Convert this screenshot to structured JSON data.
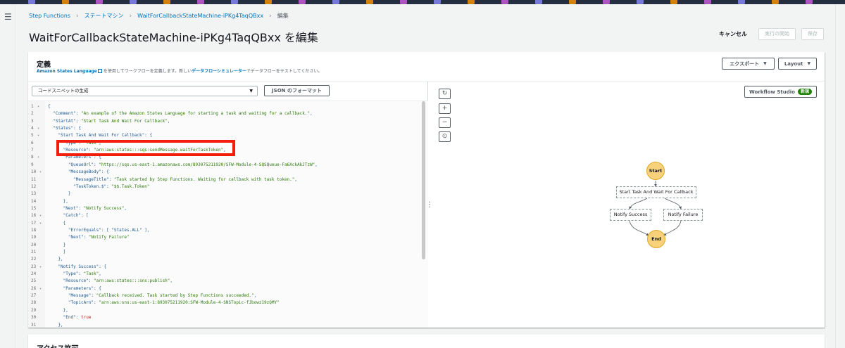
{
  "breadcrumb": {
    "items": [
      "Step Functions",
      "ステートマシン",
      "WaitForCallbackStateMachine-iPKg4TaqQBxx"
    ],
    "current": "編集"
  },
  "page": {
    "title": "WaitForCallbackStateMachine-iPKg4TaqQBxx を編集"
  },
  "header_actions": {
    "cancel": "キャンセル",
    "start_execution": "実行の開始",
    "save": "保存"
  },
  "definition": {
    "title": "定義",
    "desc_link": "Amazon States Language",
    "desc_mid": "を使用してワークフローを定義します。新しい",
    "desc_link2": "データフローシミュレーター",
    "desc_end": "でデータフローをテストしてください。",
    "export_label": "エクスポート",
    "layout_label": "Layout",
    "snippet_placeholder": "コードスニペットの生成",
    "format_button": "JSON のフォーマット"
  },
  "code_lines": [
    {
      "n": "1",
      "fold": true,
      "text": "{"
    },
    {
      "n": "2",
      "fold": false,
      "text": "  \"Comment\": \"An example of the Amazon States Language for starting a task and waiting for a callback.\","
    },
    {
      "n": "3",
      "fold": false,
      "text": "  \"StartAt\": \"Start Task And Wait For Callback\","
    },
    {
      "n": "4",
      "fold": true,
      "text": "  \"States\": {"
    },
    {
      "n": "5",
      "fold": true,
      "text": "    \"Start Task And Wait For Callback\": {"
    },
    {
      "n": "6",
      "fold": false,
      "text": "      \"Type\": \"Task\","
    },
    {
      "n": "7",
      "fold": false,
      "text": "      \"Resource\": \"arn:aws:states:::sqs:sendMessage.waitForTaskToken\","
    },
    {
      "n": "8",
      "fold": true,
      "text": "      \"Parameters\": {"
    },
    {
      "n": "9",
      "fold": false,
      "text": "        \"QueueUrl\": \"https://sqs.us-east-1.amazonaws.com/893075211920/SFW-Module-4-SQSQueue-Fa6XckAkJTzW\","
    },
    {
      "n": "10",
      "fold": true,
      "text": "        \"MessageBody\": {"
    },
    {
      "n": "11",
      "fold": false,
      "text": "          \"MessageTitle\": \"Task started by Step Functions. Waiting for callback with task token.\","
    },
    {
      "n": "12",
      "fold": false,
      "text": "          \"TaskToken.$\": \"$$.Task.Token\""
    },
    {
      "n": "13",
      "fold": false,
      "text": "        }"
    },
    {
      "n": "14",
      "fold": false,
      "text": "      },"
    },
    {
      "n": "15",
      "fold": false,
      "text": "      \"Next\": \"Notify Success\","
    },
    {
      "n": "16",
      "fold": true,
      "text": "      \"Catch\": ["
    },
    {
      "n": "17",
      "fold": true,
      "text": "      {"
    },
    {
      "n": "18",
      "fold": false,
      "text": "        \"ErrorEquals\": [ \"States.ALL\" ],"
    },
    {
      "n": "19",
      "fold": false,
      "text": "        \"Next\": \"Notify Failure\""
    },
    {
      "n": "20",
      "fold": false,
      "text": "      }"
    },
    {
      "n": "21",
      "fold": false,
      "text": "      ]"
    },
    {
      "n": "22",
      "fold": false,
      "text": "    },"
    },
    {
      "n": "23",
      "fold": true,
      "text": "    \"Notify Success\": {"
    },
    {
      "n": "24",
      "fold": false,
      "text": "      \"Type\": \"Task\","
    },
    {
      "n": "25",
      "fold": false,
      "text": "      \"Resource\": \"arn:aws:states:::sns:publish\","
    },
    {
      "n": "26",
      "fold": true,
      "text": "      \"Parameters\": {"
    },
    {
      "n": "27",
      "fold": false,
      "text": "        \"Message\": \"Callback received. Task started by Step Functions succeeded.\","
    },
    {
      "n": "28",
      "fold": false,
      "text": "        \"TopicArn\": \"arn:aws:sns:us-east-1:893075211920:SFW-Module-4-SNSTopic-fJbowz19zQMY\""
    },
    {
      "n": "29",
      "fold": false,
      "text": "      },"
    },
    {
      "n": "30",
      "fold": false,
      "text": "      \"End\": true"
    },
    {
      "n": "31",
      "fold": false,
      "text": "    },"
    }
  ],
  "canvas": {
    "tools": [
      "refresh-icon",
      "zoom-in-icon",
      "zoom-out-icon",
      "center-icon"
    ],
    "tool_glyphs": [
      "↻",
      "+",
      "−",
      "⊙"
    ],
    "workflow_studio": "Workflow Studio",
    "new_badge": "新規"
  },
  "graph": {
    "start": "Start",
    "task": "Start Task And Wait For Callback",
    "success": "Notify Success",
    "failure": "Notify Failure",
    "end": "End"
  },
  "access": {
    "title": "アクセス許可"
  },
  "colors": {
    "link": "#0073bb",
    "highlight": "#f31d0b",
    "node_fill": "#f7d27a",
    "badge": "#1d8102"
  }
}
